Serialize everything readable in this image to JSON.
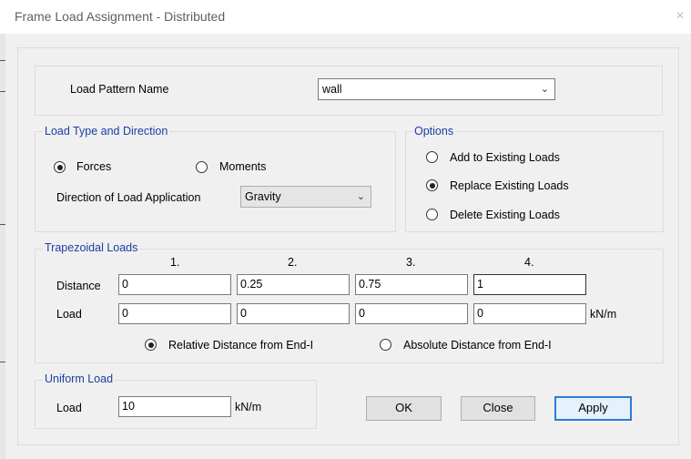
{
  "window": {
    "title": "Frame Load Assignment - Distributed",
    "close_glyph": "×"
  },
  "load_pattern": {
    "label": "Load Pattern Name",
    "value": "wall"
  },
  "load_type": {
    "legend": "Load Type and Direction",
    "forces_label": "Forces",
    "moments_label": "Moments",
    "selected": "Forces",
    "direction_label": "Direction of Load Application",
    "direction_value": "Gravity"
  },
  "options": {
    "legend": "Options",
    "add_label": "Add to Existing Loads",
    "replace_label": "Replace Existing Loads",
    "delete_label": "Delete Existing Loads",
    "selected": "Replace Existing Loads"
  },
  "trapezoidal": {
    "legend": "Trapezoidal Loads",
    "columns": [
      "1.",
      "2.",
      "3.",
      "4."
    ],
    "distance_label": "Distance",
    "load_label": "Load",
    "distances": [
      "0",
      "0.25",
      "0.75",
      "1"
    ],
    "loads": [
      "0",
      "0",
      "0",
      "0"
    ],
    "unit": "kN/m",
    "relative_label": "Relative Distance from End-I",
    "absolute_label": "Absolute Distance from End-I",
    "selected": "Relative Distance from End-I"
  },
  "uniform": {
    "legend": "Uniform Load",
    "load_label": "Load",
    "value": "10",
    "unit": "kN/m"
  },
  "buttons": {
    "ok": "OK",
    "close": "Close",
    "apply": "Apply"
  }
}
